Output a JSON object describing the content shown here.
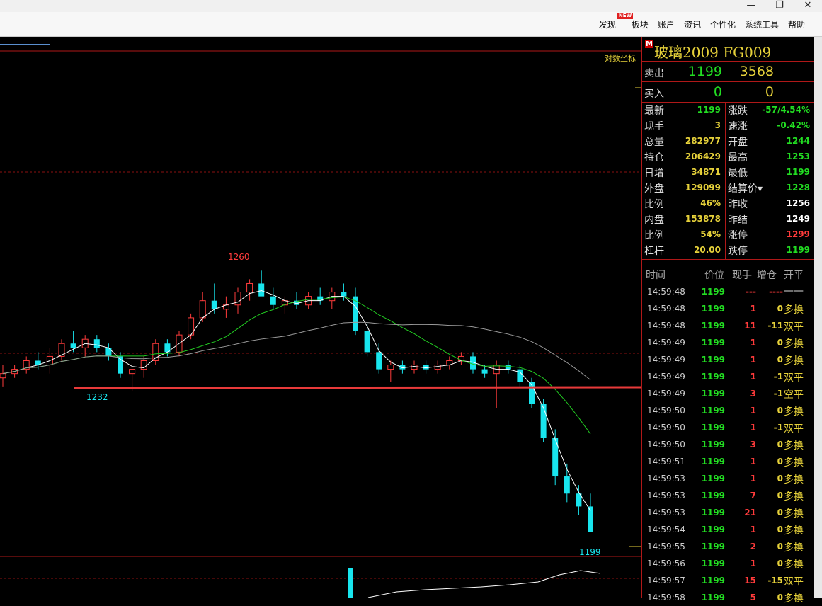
{
  "window": {
    "controls": [
      "—",
      "❐",
      "✕"
    ]
  },
  "menu": [
    {
      "label": "发现",
      "badge": "NEW"
    },
    {
      "label": "板块"
    },
    {
      "label": "账户"
    },
    {
      "label": "资讯"
    },
    {
      "label": "个性化"
    },
    {
      "label": "系统工具"
    },
    {
      "label": "帮助"
    }
  ],
  "chart": {
    "log_axis_label": "对数坐标",
    "high_label": "1260",
    "low_label_left": "1232",
    "low_label_right": "1199",
    "colors": {
      "up": "#ff3b3b",
      "down": "#18e5ee",
      "ma_short": "#ffffff",
      "ma_mid": "#22cc22",
      "ma_long": "#9a9a9a",
      "arrow": "#e83a3a"
    }
  },
  "chart_data": {
    "type": "candlestick",
    "title": "",
    "ylabel": "",
    "candles": [
      {
        "o": 1235,
        "h": 1238,
        "l": 1233,
        "c": 1236
      },
      {
        "o": 1236,
        "h": 1238,
        "l": 1235,
        "c": 1237
      },
      {
        "o": 1237,
        "h": 1240,
        "l": 1236,
        "c": 1239
      },
      {
        "o": 1239,
        "h": 1241,
        "l": 1237,
        "c": 1238
      },
      {
        "o": 1238,
        "h": 1242,
        "l": 1236,
        "c": 1240
      },
      {
        "o": 1240,
        "h": 1244,
        "l": 1239,
        "c": 1243
      },
      {
        "o": 1243,
        "h": 1246,
        "l": 1241,
        "c": 1242
      },
      {
        "o": 1242,
        "h": 1245,
        "l": 1240,
        "c": 1244
      },
      {
        "o": 1244,
        "h": 1245,
        "l": 1241,
        "c": 1242
      },
      {
        "o": 1242,
        "h": 1243,
        "l": 1239,
        "c": 1240
      },
      {
        "o": 1240,
        "h": 1241,
        "l": 1235,
        "c": 1236
      },
      {
        "o": 1236,
        "h": 1237,
        "l": 1232,
        "c": 1237
      },
      {
        "o": 1237,
        "h": 1240,
        "l": 1235,
        "c": 1239
      },
      {
        "o": 1239,
        "h": 1244,
        "l": 1238,
        "c": 1243
      },
      {
        "o": 1243,
        "h": 1244,
        "l": 1240,
        "c": 1241
      },
      {
        "o": 1241,
        "h": 1246,
        "l": 1240,
        "c": 1245
      },
      {
        "o": 1245,
        "h": 1250,
        "l": 1244,
        "c": 1249
      },
      {
        "o": 1249,
        "h": 1255,
        "l": 1248,
        "c": 1253
      },
      {
        "o": 1253,
        "h": 1257,
        "l": 1250,
        "c": 1251
      },
      {
        "o": 1251,
        "h": 1254,
        "l": 1249,
        "c": 1252
      },
      {
        "o": 1252,
        "h": 1256,
        "l": 1250,
        "c": 1255
      },
      {
        "o": 1255,
        "h": 1258,
        "l": 1253,
        "c": 1257
      },
      {
        "o": 1257,
        "h": 1260,
        "l": 1255,
        "c": 1254
      },
      {
        "o": 1254,
        "h": 1256,
        "l": 1251,
        "c": 1252
      },
      {
        "o": 1252,
        "h": 1254,
        "l": 1250,
        "c": 1253
      },
      {
        "o": 1253,
        "h": 1255,
        "l": 1251,
        "c": 1252
      },
      {
        "o": 1252,
        "h": 1255,
        "l": 1251,
        "c": 1254
      },
      {
        "o": 1254,
        "h": 1256,
        "l": 1252,
        "c": 1253
      },
      {
        "o": 1253,
        "h": 1256,
        "l": 1251,
        "c": 1255
      },
      {
        "o": 1255,
        "h": 1257,
        "l": 1253,
        "c": 1254
      },
      {
        "o": 1254,
        "h": 1256,
        "l": 1245,
        "c": 1246
      },
      {
        "o": 1246,
        "h": 1248,
        "l": 1240,
        "c": 1241
      },
      {
        "o": 1241,
        "h": 1243,
        "l": 1236,
        "c": 1237
      },
      {
        "o": 1237,
        "h": 1239,
        "l": 1234,
        "c": 1238
      },
      {
        "o": 1238,
        "h": 1239,
        "l": 1236,
        "c": 1237
      },
      {
        "o": 1237,
        "h": 1239,
        "l": 1236,
        "c": 1238
      },
      {
        "o": 1238,
        "h": 1239,
        "l": 1236,
        "c": 1237
      },
      {
        "o": 1237,
        "h": 1239,
        "l": 1236,
        "c": 1238
      },
      {
        "o": 1238,
        "h": 1240,
        "l": 1237,
        "c": 1239
      },
      {
        "o": 1239,
        "h": 1241,
        "l": 1238,
        "c": 1240
      },
      {
        "o": 1240,
        "h": 1241,
        "l": 1236,
        "c": 1237
      },
      {
        "o": 1237,
        "h": 1238,
        "l": 1235,
        "c": 1236
      },
      {
        "o": 1236,
        "h": 1239,
        "l": 1228,
        "c": 1238
      },
      {
        "o": 1238,
        "h": 1239,
        "l": 1236,
        "c": 1237
      },
      {
        "o": 1237,
        "h": 1238,
        "l": 1233,
        "c": 1234
      },
      {
        "o": 1234,
        "h": 1235,
        "l": 1228,
        "c": 1229
      },
      {
        "o": 1229,
        "h": 1230,
        "l": 1220,
        "c": 1221
      },
      {
        "o": 1221,
        "h": 1223,
        "l": 1210,
        "c": 1212
      },
      {
        "o": 1212,
        "h": 1215,
        "l": 1206,
        "c": 1208
      },
      {
        "o": 1208,
        "h": 1210,
        "l": 1203,
        "c": 1205
      },
      {
        "o": 1205,
        "h": 1208,
        "l": 1199,
        "c": 1199
      }
    ],
    "ylim": [
      1195,
      1265
    ],
    "annotations": [
      "1260",
      "1232",
      "1199",
      "对数坐标"
    ]
  },
  "panel": {
    "m_badge": "M",
    "title": "玻璃2009  FG009",
    "sell": {
      "label": "卖出",
      "price": "1199",
      "qty": "3568"
    },
    "buy": {
      "label": "买入",
      "price": "0",
      "qty": "0"
    },
    "stats_left": [
      {
        "k": "最新",
        "v": "1199",
        "color": "#22dd22"
      },
      {
        "k": "现手",
        "v": "3",
        "color": "#e6d13a"
      },
      {
        "k": "总量",
        "v": "282977",
        "color": "#e6d13a"
      },
      {
        "k": "持仓",
        "v": "206429",
        "color": "#e6d13a"
      },
      {
        "k": "日增",
        "v": "34871",
        "color": "#e6d13a"
      },
      {
        "k": "外盘",
        "v": "129099",
        "color": "#e6d13a"
      },
      {
        "k": "比例",
        "v": "46%",
        "color": "#e6d13a"
      },
      {
        "k": "内盘",
        "v": "153878",
        "color": "#e6d13a"
      },
      {
        "k": "比例",
        "v": "54%",
        "color": "#e6d13a"
      },
      {
        "k": "杠杆",
        "v": "20.00",
        "color": "#e6d13a"
      }
    ],
    "stats_right": [
      {
        "k": "涨跌",
        "v": "-57/4.54%",
        "color": "#22dd22"
      },
      {
        "k": "速涨",
        "v": "-0.42%",
        "color": "#22dd22"
      },
      {
        "k": "开盘",
        "v": "1244",
        "color": "#22dd22"
      },
      {
        "k": "最高",
        "v": "1253",
        "color": "#22dd22"
      },
      {
        "k": "最低",
        "v": "1199",
        "color": "#22dd22"
      },
      {
        "k": "结算价▾",
        "v": "1228",
        "color": "#22dd22"
      },
      {
        "k": "昨收",
        "v": "1256",
        "color": "#ffffff"
      },
      {
        "k": "昨结",
        "v": "1249",
        "color": "#ffffff"
      },
      {
        "k": "涨停",
        "v": "1299",
        "color": "#ff3b3b"
      },
      {
        "k": "跌停",
        "v": "1199",
        "color": "#22dd22"
      }
    ],
    "ticks_header": {
      "time": "时间",
      "price": "价位",
      "vol": "现手",
      "oi": "增仓",
      "type": "开平"
    },
    "ticks": [
      {
        "time": "14:59:48",
        "price": "1199",
        "vol": "---",
        "oi": "----",
        "type": "——"
      },
      {
        "time": "14:59:48",
        "price": "1199",
        "vol": "1",
        "oi": "0",
        "type": "多换"
      },
      {
        "time": "14:59:48",
        "price": "1199",
        "vol": "11",
        "oi": "-11",
        "type": "双平"
      },
      {
        "time": "14:59:49",
        "price": "1199",
        "vol": "1",
        "oi": "0",
        "type": "多换"
      },
      {
        "time": "14:59:49",
        "price": "1199",
        "vol": "1",
        "oi": "0",
        "type": "多换"
      },
      {
        "time": "14:59:49",
        "price": "1199",
        "vol": "1",
        "oi": "-1",
        "type": "双平"
      },
      {
        "time": "14:59:49",
        "price": "1199",
        "vol": "3",
        "oi": "-1",
        "type": "空平"
      },
      {
        "time": "14:59:50",
        "price": "1199",
        "vol": "1",
        "oi": "0",
        "type": "多换"
      },
      {
        "time": "14:59:50",
        "price": "1199",
        "vol": "1",
        "oi": "-1",
        "type": "双平"
      },
      {
        "time": "14:59:50",
        "price": "1199",
        "vol": "3",
        "oi": "0",
        "type": "多换"
      },
      {
        "time": "14:59:51",
        "price": "1199",
        "vol": "1",
        "oi": "0",
        "type": "多换"
      },
      {
        "time": "14:59:53",
        "price": "1199",
        "vol": "1",
        "oi": "0",
        "type": "多换"
      },
      {
        "time": "14:59:53",
        "price": "1199",
        "vol": "7",
        "oi": "0",
        "type": "多换"
      },
      {
        "time": "14:59:53",
        "price": "1199",
        "vol": "21",
        "oi": "0",
        "type": "多换"
      },
      {
        "time": "14:59:54",
        "price": "1199",
        "vol": "1",
        "oi": "0",
        "type": "多换"
      },
      {
        "time": "14:59:55",
        "price": "1199",
        "vol": "2",
        "oi": "0",
        "type": "多换"
      },
      {
        "time": "14:59:56",
        "price": "1199",
        "vol": "1",
        "oi": "0",
        "type": "多换"
      },
      {
        "time": "14:59:57",
        "price": "1199",
        "vol": "15",
        "oi": "-15",
        "type": "双平"
      },
      {
        "time": "14:59:58",
        "price": "1199",
        "vol": "5",
        "oi": "0",
        "type": "多换"
      }
    ]
  }
}
